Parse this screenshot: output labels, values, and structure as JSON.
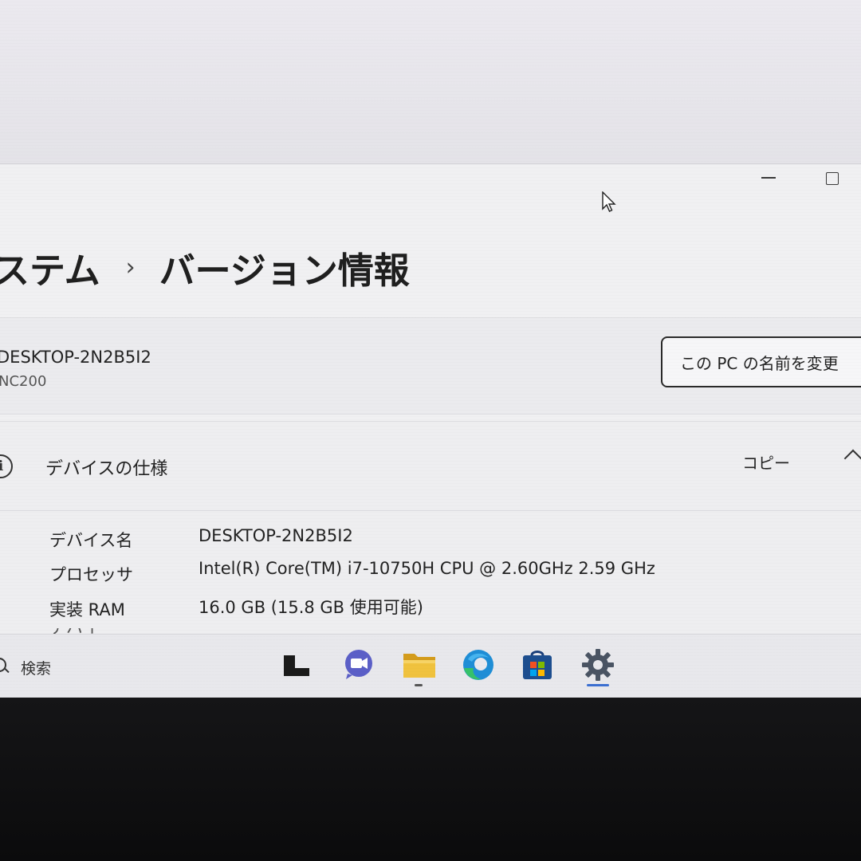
{
  "settings": {
    "breadcrumb": {
      "parent": "ステム",
      "separator": "›",
      "current": "バージョン情報"
    },
    "pc": {
      "name": "DESKTOP-2N2B5I2",
      "model": "NC200",
      "rename_button": "この PC の名前を変更"
    },
    "device_specs": {
      "title": "デバイスの仕様",
      "copy_label": "コピー",
      "info_icon": "i",
      "rows": [
        {
          "label": "デバイス名",
          "value": "DESKTOP-2N2B5I2"
        },
        {
          "label": "プロセッサ",
          "value": "Intel(R) Core(TM) i7-10750H CPU @ 2.60GHz   2.59 GHz"
        },
        {
          "label": "実装 RAM",
          "value": "16.0 GB (15.8 GB 使用可能)"
        }
      ],
      "partial_row_label": "デバイス"
    }
  },
  "taskbar": {
    "search_label": "検索",
    "icons": [
      "task-view-icon",
      "chat-icon",
      "file-explorer-icon",
      "edge-icon",
      "store-icon",
      "settings-icon"
    ]
  },
  "colors": {
    "screen_bg": "#eceaf0",
    "window_bg": "#f0f0f2",
    "bezel": "#0e0e10",
    "edge_blue": "#1f8ed6",
    "edge_green": "#36c26a",
    "folder_yellow": "#e8b733",
    "chat_purple": "#5b5fc7",
    "indicator_blue": "#3b6fd1"
  }
}
